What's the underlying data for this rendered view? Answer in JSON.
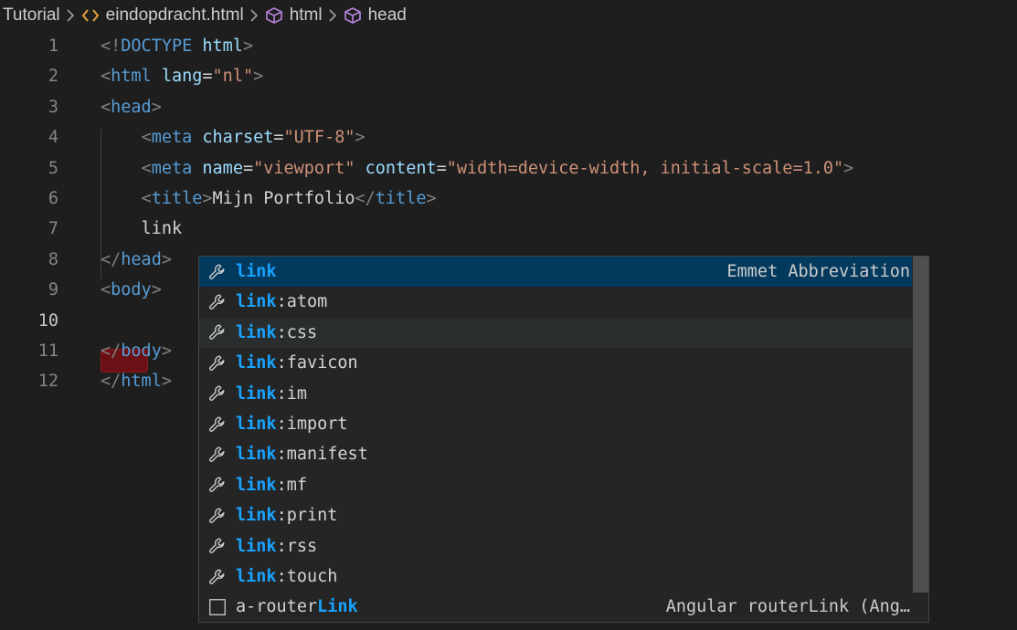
{
  "breadcrumb": {
    "items": [
      {
        "label": "Tutorial",
        "icon": ""
      },
      {
        "label": "eindopdracht.html",
        "icon": "html-file-icon"
      },
      {
        "label": "html",
        "icon": "cube-icon"
      },
      {
        "label": "head",
        "icon": "cube-icon"
      }
    ]
  },
  "editor": {
    "lines": [
      {
        "n": "1",
        "parts": [
          {
            "c": "t-br",
            "t": "<!"
          },
          {
            "c": "t-doc",
            "t": "DOCTYPE"
          },
          {
            "c": "t-txt",
            "t": " "
          },
          {
            "c": "t-attr",
            "t": "html"
          },
          {
            "c": "t-br",
            "t": ">"
          }
        ]
      },
      {
        "n": "2",
        "parts": [
          {
            "c": "t-br",
            "t": "<"
          },
          {
            "c": "t-tag",
            "t": "html"
          },
          {
            "c": "t-txt",
            "t": " "
          },
          {
            "c": "t-attr",
            "t": "lang"
          },
          {
            "c": "t-txt",
            "t": "="
          },
          {
            "c": "t-str",
            "t": "\"nl\""
          },
          {
            "c": "t-br",
            "t": ">"
          }
        ]
      },
      {
        "n": "3",
        "parts": [
          {
            "c": "t-br",
            "t": "<"
          },
          {
            "c": "t-tag",
            "t": "head"
          },
          {
            "c": "t-br",
            "t": ">"
          }
        ]
      },
      {
        "n": "4",
        "parts": [
          {
            "c": "t-txt",
            "t": "    "
          },
          {
            "c": "t-br",
            "t": "<"
          },
          {
            "c": "t-tag",
            "t": "meta"
          },
          {
            "c": "t-txt",
            "t": " "
          },
          {
            "c": "t-attr",
            "t": "charset"
          },
          {
            "c": "t-txt",
            "t": "="
          },
          {
            "c": "t-str",
            "t": "\"UTF-8\""
          },
          {
            "c": "t-br",
            "t": ">"
          }
        ]
      },
      {
        "n": "5",
        "parts": [
          {
            "c": "t-txt",
            "t": "    "
          },
          {
            "c": "t-br",
            "t": "<"
          },
          {
            "c": "t-tag",
            "t": "meta"
          },
          {
            "c": "t-txt",
            "t": " "
          },
          {
            "c": "t-attr",
            "t": "name"
          },
          {
            "c": "t-txt",
            "t": "="
          },
          {
            "c": "t-str",
            "t": "\"viewport\""
          },
          {
            "c": "t-txt",
            "t": " "
          },
          {
            "c": "t-attr",
            "t": "content"
          },
          {
            "c": "t-txt",
            "t": "="
          },
          {
            "c": "t-str",
            "t": "\"width=device-width, initial-scale=1.0\""
          },
          {
            "c": "t-br",
            "t": ">"
          }
        ]
      },
      {
        "n": "6",
        "parts": [
          {
            "c": "t-txt",
            "t": "    "
          },
          {
            "c": "t-br",
            "t": "<"
          },
          {
            "c": "t-tag",
            "t": "title"
          },
          {
            "c": "t-br",
            "t": ">"
          },
          {
            "c": "t-txt",
            "t": "Mijn Portfolio"
          },
          {
            "c": "t-br",
            "t": "</"
          },
          {
            "c": "t-tag",
            "t": "title"
          },
          {
            "c": "t-br",
            "t": ">"
          }
        ]
      },
      {
        "n": "7",
        "parts": [
          {
            "c": "t-txt",
            "t": "    link"
          }
        ]
      },
      {
        "n": "8",
        "parts": [
          {
            "c": "t-br",
            "t": "</"
          },
          {
            "c": "t-tag",
            "t": "head"
          },
          {
            "c": "t-br",
            "t": ">"
          }
        ]
      },
      {
        "n": "9",
        "parts": [
          {
            "c": "t-br",
            "t": "<"
          },
          {
            "c": "t-tag",
            "t": "body"
          },
          {
            "c": "t-br",
            "t": ">"
          }
        ]
      },
      {
        "n": "10",
        "parts": []
      },
      {
        "n": "11",
        "parts": [
          {
            "c": "t-br",
            "t": "</"
          },
          {
            "c": "t-tag",
            "t": "body"
          },
          {
            "c": "t-br",
            "t": ">"
          }
        ]
      },
      {
        "n": "12",
        "parts": [
          {
            "c": "t-br",
            "t": "</"
          },
          {
            "c": "t-tag",
            "t": "html"
          },
          {
            "c": "t-br",
            "t": ">"
          }
        ]
      }
    ],
    "active_line": "10"
  },
  "suggest": {
    "items": [
      {
        "icon": "wrench-icon",
        "match": "link",
        "rest": "",
        "detail": "Emmet Abbreviation",
        "state": "selected"
      },
      {
        "icon": "wrench-icon",
        "match": "link",
        "rest": ":atom",
        "detail": "",
        "state": ""
      },
      {
        "icon": "wrench-icon",
        "match": "link",
        "rest": ":css",
        "detail": "",
        "state": "hover"
      },
      {
        "icon": "wrench-icon",
        "match": "link",
        "rest": ":favicon",
        "detail": "",
        "state": ""
      },
      {
        "icon": "wrench-icon",
        "match": "link",
        "rest": ":im",
        "detail": "",
        "state": ""
      },
      {
        "icon": "wrench-icon",
        "match": "link",
        "rest": ":import",
        "detail": "",
        "state": ""
      },
      {
        "icon": "wrench-icon",
        "match": "link",
        "rest": ":manifest",
        "detail": "",
        "state": ""
      },
      {
        "icon": "wrench-icon",
        "match": "link",
        "rest": ":mf",
        "detail": "",
        "state": ""
      },
      {
        "icon": "wrench-icon",
        "match": "link",
        "rest": ":print",
        "detail": "",
        "state": ""
      },
      {
        "icon": "wrench-icon",
        "match": "link",
        "rest": ":rss",
        "detail": "",
        "state": ""
      },
      {
        "icon": "wrench-icon",
        "match": "link",
        "rest": ":touch",
        "detail": "",
        "state": ""
      },
      {
        "icon": "snippet-icon",
        "prefix": "a-router",
        "match": "Link",
        "rest": "",
        "detail": "Angular routerLink (Ang…",
        "state": ""
      }
    ]
  },
  "colors": {
    "background": "#1e1e1e",
    "tag": "#569cd6",
    "attribute": "#9cdcfe",
    "string": "#ce9178",
    "match_highlight": "#18a3ff",
    "selected_row": "#04395e",
    "error_marker": "#6b1014"
  }
}
